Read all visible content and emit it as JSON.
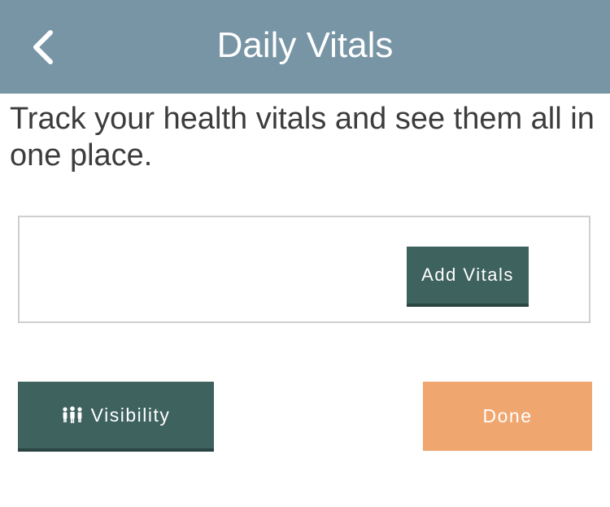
{
  "header": {
    "title": "Daily Vitals",
    "back_icon": "chevron-left-icon",
    "background_color": "#7895a6"
  },
  "intro": {
    "text": "Track your health vitals and see them all in one place."
  },
  "vitals_card": {
    "add_button_label": "Add Vitals"
  },
  "footer": {
    "visibility_label": "Visibility",
    "visibility_icon": "people-icon",
    "done_label": "Done"
  },
  "colors": {
    "primary_button": "#3e625e",
    "done_button": "#f0a66f",
    "card_border": "#cfcfcf"
  }
}
